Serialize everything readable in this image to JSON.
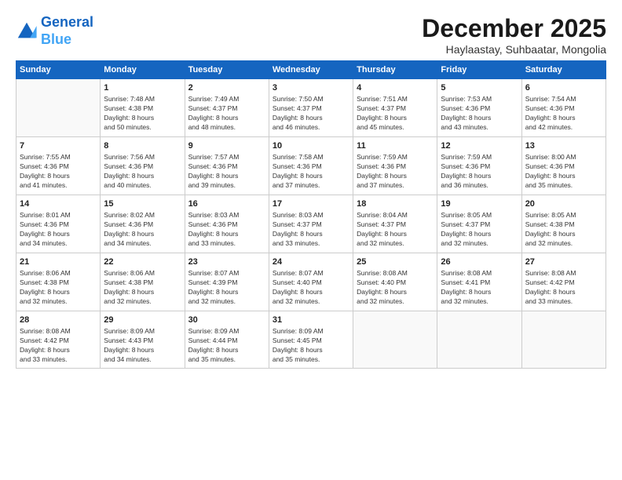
{
  "header": {
    "logo_line1": "General",
    "logo_line2": "Blue",
    "month_title": "December 2025",
    "location": "Haylaastay, Suhbaatar, Mongolia"
  },
  "weekdays": [
    "Sunday",
    "Monday",
    "Tuesday",
    "Wednesday",
    "Thursday",
    "Friday",
    "Saturday"
  ],
  "weeks": [
    [
      {
        "day": "",
        "info": ""
      },
      {
        "day": "1",
        "info": "Sunrise: 7:48 AM\nSunset: 4:38 PM\nDaylight: 8 hours\nand 50 minutes."
      },
      {
        "day": "2",
        "info": "Sunrise: 7:49 AM\nSunset: 4:37 PM\nDaylight: 8 hours\nand 48 minutes."
      },
      {
        "day": "3",
        "info": "Sunrise: 7:50 AM\nSunset: 4:37 PM\nDaylight: 8 hours\nand 46 minutes."
      },
      {
        "day": "4",
        "info": "Sunrise: 7:51 AM\nSunset: 4:37 PM\nDaylight: 8 hours\nand 45 minutes."
      },
      {
        "day": "5",
        "info": "Sunrise: 7:53 AM\nSunset: 4:36 PM\nDaylight: 8 hours\nand 43 minutes."
      },
      {
        "day": "6",
        "info": "Sunrise: 7:54 AM\nSunset: 4:36 PM\nDaylight: 8 hours\nand 42 minutes."
      }
    ],
    [
      {
        "day": "7",
        "info": "Sunrise: 7:55 AM\nSunset: 4:36 PM\nDaylight: 8 hours\nand 41 minutes."
      },
      {
        "day": "8",
        "info": "Sunrise: 7:56 AM\nSunset: 4:36 PM\nDaylight: 8 hours\nand 40 minutes."
      },
      {
        "day": "9",
        "info": "Sunrise: 7:57 AM\nSunset: 4:36 PM\nDaylight: 8 hours\nand 39 minutes."
      },
      {
        "day": "10",
        "info": "Sunrise: 7:58 AM\nSunset: 4:36 PM\nDaylight: 8 hours\nand 37 minutes."
      },
      {
        "day": "11",
        "info": "Sunrise: 7:59 AM\nSunset: 4:36 PM\nDaylight: 8 hours\nand 37 minutes."
      },
      {
        "day": "12",
        "info": "Sunrise: 7:59 AM\nSunset: 4:36 PM\nDaylight: 8 hours\nand 36 minutes."
      },
      {
        "day": "13",
        "info": "Sunrise: 8:00 AM\nSunset: 4:36 PM\nDaylight: 8 hours\nand 35 minutes."
      }
    ],
    [
      {
        "day": "14",
        "info": "Sunrise: 8:01 AM\nSunset: 4:36 PM\nDaylight: 8 hours\nand 34 minutes."
      },
      {
        "day": "15",
        "info": "Sunrise: 8:02 AM\nSunset: 4:36 PM\nDaylight: 8 hours\nand 34 minutes."
      },
      {
        "day": "16",
        "info": "Sunrise: 8:03 AM\nSunset: 4:36 PM\nDaylight: 8 hours\nand 33 minutes."
      },
      {
        "day": "17",
        "info": "Sunrise: 8:03 AM\nSunset: 4:37 PM\nDaylight: 8 hours\nand 33 minutes."
      },
      {
        "day": "18",
        "info": "Sunrise: 8:04 AM\nSunset: 4:37 PM\nDaylight: 8 hours\nand 32 minutes."
      },
      {
        "day": "19",
        "info": "Sunrise: 8:05 AM\nSunset: 4:37 PM\nDaylight: 8 hours\nand 32 minutes."
      },
      {
        "day": "20",
        "info": "Sunrise: 8:05 AM\nSunset: 4:38 PM\nDaylight: 8 hours\nand 32 minutes."
      }
    ],
    [
      {
        "day": "21",
        "info": "Sunrise: 8:06 AM\nSunset: 4:38 PM\nDaylight: 8 hours\nand 32 minutes."
      },
      {
        "day": "22",
        "info": "Sunrise: 8:06 AM\nSunset: 4:38 PM\nDaylight: 8 hours\nand 32 minutes."
      },
      {
        "day": "23",
        "info": "Sunrise: 8:07 AM\nSunset: 4:39 PM\nDaylight: 8 hours\nand 32 minutes."
      },
      {
        "day": "24",
        "info": "Sunrise: 8:07 AM\nSunset: 4:40 PM\nDaylight: 8 hours\nand 32 minutes."
      },
      {
        "day": "25",
        "info": "Sunrise: 8:08 AM\nSunset: 4:40 PM\nDaylight: 8 hours\nand 32 minutes."
      },
      {
        "day": "26",
        "info": "Sunrise: 8:08 AM\nSunset: 4:41 PM\nDaylight: 8 hours\nand 32 minutes."
      },
      {
        "day": "27",
        "info": "Sunrise: 8:08 AM\nSunset: 4:42 PM\nDaylight: 8 hours\nand 33 minutes."
      }
    ],
    [
      {
        "day": "28",
        "info": "Sunrise: 8:08 AM\nSunset: 4:42 PM\nDaylight: 8 hours\nand 33 minutes."
      },
      {
        "day": "29",
        "info": "Sunrise: 8:09 AM\nSunset: 4:43 PM\nDaylight: 8 hours\nand 34 minutes."
      },
      {
        "day": "30",
        "info": "Sunrise: 8:09 AM\nSunset: 4:44 PM\nDaylight: 8 hours\nand 35 minutes."
      },
      {
        "day": "31",
        "info": "Sunrise: 8:09 AM\nSunset: 4:45 PM\nDaylight: 8 hours\nand 35 minutes."
      },
      {
        "day": "",
        "info": ""
      },
      {
        "day": "",
        "info": ""
      },
      {
        "day": "",
        "info": ""
      }
    ]
  ]
}
